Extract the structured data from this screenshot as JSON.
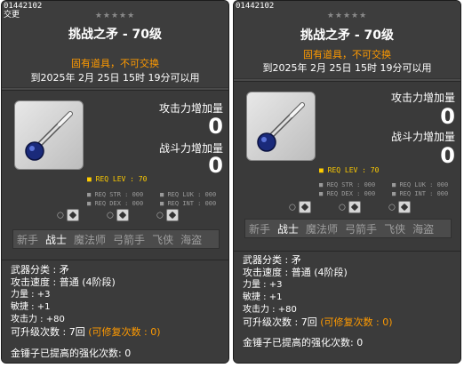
{
  "cards": [
    {
      "item_id": "01442102",
      "item_id_sub": "交更",
      "stars": "★★★★★",
      "title": "挑战之矛 - 70级",
      "tradeable": "固有道具，不可交换",
      "expiry": "到2025年 2月 25日 15时 19分可以用",
      "attack_increase_label": "攻击力增加量",
      "attack_increase_value": "0",
      "power_increase_label": "战斗力增加量",
      "power_increase_value": "0",
      "req_lev": "REQ LEV :  70",
      "req_str": "REQ STR : 000",
      "req_luk": "REQ LUK : 000",
      "req_dex": "REQ DEX : 000",
      "req_int": "REQ INT : 000",
      "jobs": [
        "新手",
        "战士",
        "魔法师",
        "弓箭手",
        "飞侠",
        "海盗"
      ],
      "active_job": "战士",
      "weapon_type": "武器分类 :  矛",
      "attack_speed": "攻击速度 :  普通 (4阶段)",
      "str": "力量 :  +3",
      "dex": "敏捷 :  +1",
      "attack": "攻击力 :  +80",
      "upgrades": "可升级次数 :  7回",
      "repair": "(可修复次数 :  0)",
      "hammer": "金锤子已提高的强化次数: 0"
    },
    {
      "item_id": "01442102",
      "stars": "★★★★★",
      "title": "挑战之矛 - 70级",
      "tradeable": "固有道具，不可交换",
      "expiry": "到2025年 2月 25日 15时 19分可以用",
      "attack_increase_label": "攻击力增加量",
      "attack_increase_value": "0",
      "power_increase_label": "战斗力增加量",
      "power_increase_value": "0",
      "req_lev": "REQ LEV :  70",
      "req_str": "REQ STR : 000",
      "req_luk": "REQ LUK : 000",
      "req_dex": "REQ DEX : 000",
      "req_int": "REQ INT : 000",
      "jobs": [
        "新手",
        "战士",
        "魔法师",
        "弓箭手",
        "飞侠",
        "海盗"
      ],
      "active_job": "战士",
      "weapon_type": "武器分类 :  矛",
      "attack_speed": "攻击速度 :  普通 (4阶段)",
      "str": "力量 :  +3",
      "dex": "敏捷 :  +1",
      "attack": "攻击力 :  +80",
      "upgrades": "可升级次数 :  7回",
      "repair": "(可修复次数 :  0)",
      "hammer": "金锤子已提高的强化次数: 0"
    }
  ],
  "colors": {
    "panel": "#4a4a4a",
    "accent_orange": "#ff9a00",
    "req_yellow": "#ffcc00",
    "muted_text": "#9d9d9d"
  },
  "icons": {
    "item": "spear-orb-icon",
    "element_icons": [
      "fire-icon",
      "ice-icon",
      "lightning-icon"
    ]
  }
}
